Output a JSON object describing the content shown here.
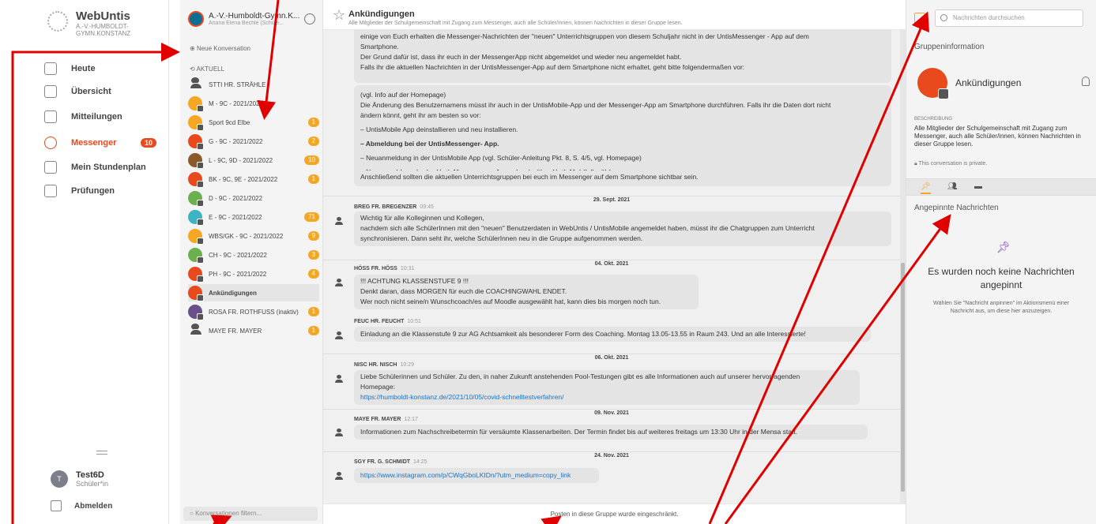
{
  "nav": {
    "app_name": "WebUntis",
    "school": "A.-V.-HUMBOLDT-GYMN.KONSTANZ",
    "items": [
      {
        "label": "Heute",
        "icon": "dashboard-icon"
      },
      {
        "label": "Übersicht",
        "icon": "overview-icon"
      },
      {
        "label": "Mitteilungen",
        "icon": "mail-icon"
      },
      {
        "label": "Messenger",
        "icon": "chat-bubble-icon",
        "badge": "10"
      },
      {
        "label": "Mein Stundenplan",
        "icon": "calendar-icon"
      },
      {
        "label": "Prüfungen",
        "icon": "exams-icon"
      }
    ],
    "user_initial": "T",
    "user_name": "Test6D",
    "user_role": "Schüler*in",
    "logout": "Abmelden"
  },
  "conversations": {
    "school": "A.-V.-Humboldt-Gymn.K...",
    "user_sub": "Ariana Elena Bechle (Schüle...",
    "new_conversation": "Neue Konversation",
    "section": "AKTUELL",
    "items": [
      {
        "label": "STTI HR. STRÄHLE",
        "badge": "",
        "color": "",
        "type": "person"
      },
      {
        "label": "M - 9C - 2021/2022",
        "badge": "",
        "color": "#f5a623",
        "type": "group"
      },
      {
        "label": "Sport 9cd Elbe",
        "badge": "1",
        "color": "#f5a623",
        "type": "group"
      },
      {
        "label": "G - 9C - 2021/2022",
        "badge": "2",
        "color": "#e8491d",
        "type": "group"
      },
      {
        "label": "L - 9C, 9D - 2021/2022",
        "badge": "10",
        "color": "#8b5a2b",
        "type": "group"
      },
      {
        "label": "BK - 9C, 9E - 2021/2022",
        "badge": "1",
        "color": "#e8491d",
        "type": "group"
      },
      {
        "label": "D - 9C - 2021/2022",
        "badge": "",
        "color": "#6ab04c",
        "type": "group"
      },
      {
        "label": "E - 9C - 2021/2022",
        "badge": "71",
        "color": "#3cb4c4",
        "type": "group"
      },
      {
        "label": "WBS/GK - 9C - 2021/2022",
        "badge": "9",
        "color": "#f5a623",
        "type": "group"
      },
      {
        "label": "CH - 9C - 2021/2022",
        "badge": "3",
        "color": "#6ab04c",
        "type": "group"
      },
      {
        "label": "PH - 9C - 2021/2022",
        "badge": "4",
        "color": "#e8491d",
        "type": "group"
      },
      {
        "label": "Ankündigungen",
        "badge": "",
        "color": "#e8491d",
        "type": "group"
      },
      {
        "label": "ROSA FR. ROTHFUSS (inaktiv)",
        "badge": "1",
        "color": "#6b4f8a",
        "type": "group"
      },
      {
        "label": "MAYE FR. MAYER",
        "badge": "1",
        "color": "",
        "type": "person"
      }
    ],
    "filter_placeholder": "Konversationen filtern..."
  },
  "main": {
    "title": "Ankündigungen",
    "description": "Alle Mitglieder der Schulgemeinschaft mit Zugang zum Messenger, auch alle Schüler/innen, können Nachrichten in dieser Gruppe lesen.",
    "msg0": {
      "lines": [
        "einige von Euch erhalten die Messenger-Nachrichten der \"neuen\" Unterrichtsgruppen von diesem Schuljahr nicht in der UntisMessenger - App auf dem",
        "Smartphone.",
        "Der Grund dafür ist, dass ihr euch in der MessengerApp nicht abgemeldet und wieder neu angemeldet habt.",
        "Falls ihr die aktuellen Nachrichten in der UntisMessenger-App auf dem Smartphone nicht erhaltet, geht bitte folgendermaßen vor:"
      ],
      "para2": [
        "(vgl. Info auf der Homepage)",
        "Die Änderung des Benutzernamens müsst ihr auch in der UntisMobile-App und der Messenger-App am Smartphone durchführen. Falls ihr die Daten dort nicht",
        "ändern könnt, geht ihr am besten so vor:"
      ],
      "b1": "– UntisMobile App deinstallieren und neu installieren.",
      "b2": "– Abmeldung bei der UntisMessenger- App.",
      "b3": "– Neuanmeldung in der UntisMobile App (vgl. Schüler-Anleitung Pkt. 8, S. 4/5, vgl. Homepage)",
      "b4": "– Neuanmeldung in der UntisMessenger – App: „Login über UntisMobile\" wählen.",
      "closing": "Anschließend sollten die aktuellen Unterrichtsgruppen bei euch im Messenger auf dem Smartphone sichtbar sein."
    },
    "dates": [
      "29. Sept. 2021",
      "04. Okt. 2021",
      "06. Okt. 2021",
      "09. Nov. 2021",
      "24. Nov. 2021"
    ],
    "messages": [
      {
        "sender": "BREG FR. BREGENZER",
        "time": "09:45",
        "lines": [
          "Wichtig für alle Kolleginnen und Kollegen,",
          "nachdem sich alle SchülerInnen mit den \"neuen\" Benutzerdaten in WebUntis / UntisMobile angemeldet haben, müsst ihr die Chatgruppen zum Unterricht",
          "synchronisieren. Dann seht ihr, welche SchülerInnen neu in die Gruppe aufgenommen werden."
        ]
      },
      {
        "sender": "HÖSS FR. HÖSS",
        "time": "10:31",
        "lines": [
          "!!! ACHTUNG KLASSENSTUFE 9 !!!",
          "Denkt daran, dass MORGEN für euch die COACHINGWAHL ENDET.",
          "Wer noch nicht seine/n Wunschcoach/es auf Moodle ausgewählt hat, kann dies bis morgen noch tun."
        ]
      },
      {
        "sender": "FEUC HR. FEUCHT",
        "time": "10:51",
        "lines": [
          "Einladung an die Klassenstufe 9 zur AG Achtsamkeit als besonderer Form des Coaching. Montag 13.05-13.55 in Raum 243. Und an alle Interessierte!"
        ]
      },
      {
        "sender": "NISC HR. NISCH",
        "time": "10:29",
        "lines": [
          "Liebe Schülerinnen und Schüler. Zu den, in naher Zukunft anstehenden Pool-Testungen gibt es alle Informationen auch auf unserer hervorragenden",
          "Homepage:"
        ],
        "link": "https://humboldt-konstanz.de/2021/10/05/covid-schnelltestverfahren/"
      },
      {
        "sender": "MAYE FR. MAYER",
        "time": "12:17",
        "lines": [
          "Informationen zum Nachschreibetermin für versäumte Klassenarbeiten. Der Termin findet bis auf weiteres freitags um 13:30 Uhr in der Mensa statt."
        ]
      },
      {
        "sender": "SGY FR. G. SCHMIDT",
        "time": "14:25",
        "lines": [],
        "link": "https://www.instagram.com/p/CWqGboLKIDn/?utm_medium=copy_link"
      }
    ],
    "restricted": "Posten in diese Gruppe wurde eingeschränkt."
  },
  "info": {
    "search_placeholder": "Nachrichten durchsuchen",
    "heading": "Gruppeninformation",
    "group_name": "Ankündigungen",
    "desc_label": "BESCHREIBUNG",
    "desc": "Alle Mitglieder der Schulgemeinschaft mit Zugang zum Messenger, auch alle Schüler/innen, können Nachrichten in dieser Gruppe lesen.",
    "private": "This conversation is private.",
    "pinned_heading": "Angepinnte Nachrichten",
    "no_pins": "Es wurden noch keine Nachrichten angepinnt",
    "no_pins_hint": "Wählen Sie \"Nachricht anpinnen\" im Aktionsmenü einer Nachricht aus, um diese hier anzuzeigen."
  },
  "colors": {
    "accent": "#e8491d",
    "badge": "#f5a623",
    "annotation": "#e00000"
  }
}
